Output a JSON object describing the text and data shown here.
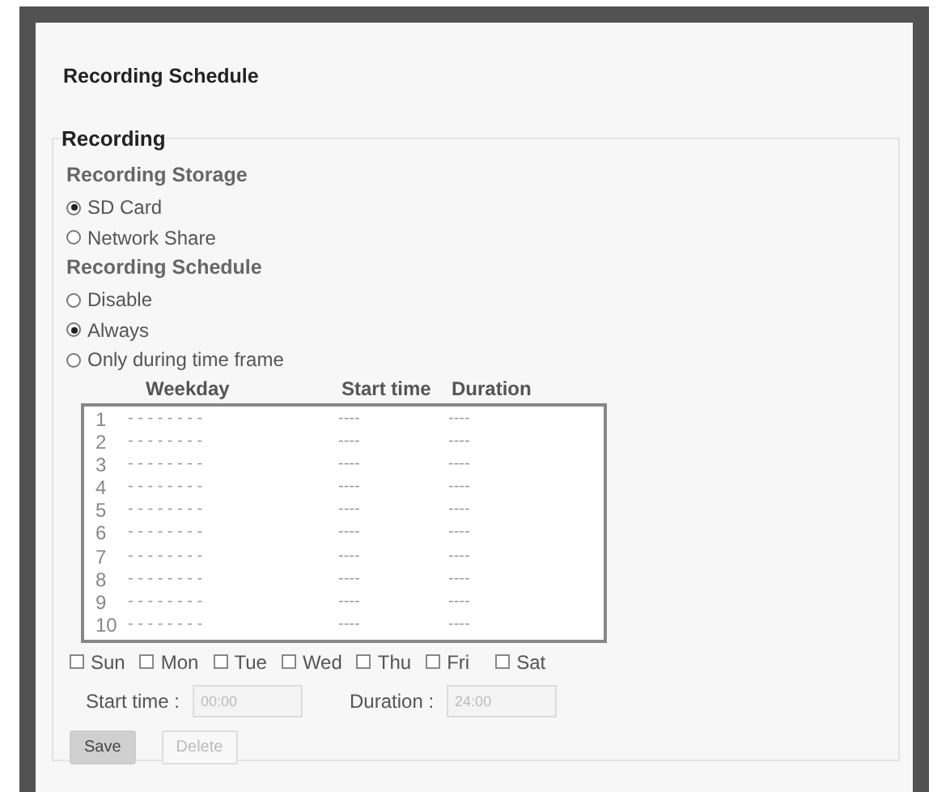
{
  "page_title": "Recording Schedule",
  "section": {
    "legend": "Recording",
    "storage": {
      "heading": "Recording Storage",
      "options": [
        {
          "label": "SD Card",
          "selected": true
        },
        {
          "label": "Network Share",
          "selected": false
        }
      ]
    },
    "schedule": {
      "heading": "Recording Schedule",
      "options": [
        {
          "label": "Disable",
          "selected": false
        },
        {
          "label": "Always",
          "selected": true
        },
        {
          "label": "Only during time frame",
          "selected": false
        }
      ]
    },
    "list": {
      "columns": [
        "Weekday",
        "Start time",
        "Duration"
      ],
      "rows": [
        {
          "index": "1",
          "weekday": "- - - - - - - -",
          "start": "----",
          "duration": "----"
        },
        {
          "index": "2",
          "weekday": "- - - - - - - -",
          "start": "----",
          "duration": "----"
        },
        {
          "index": "3",
          "weekday": "- - - - - - - -",
          "start": "----",
          "duration": "----"
        },
        {
          "index": "4",
          "weekday": "- - - - - - - -",
          "start": "----",
          "duration": "----"
        },
        {
          "index": "5",
          "weekday": "- - - - - - - -",
          "start": "----",
          "duration": "----"
        },
        {
          "index": "6",
          "weekday": "- - - - - - - -",
          "start": "----",
          "duration": "----"
        },
        {
          "index": "7",
          "weekday": "- - - - - - - -",
          "start": "----",
          "duration": "----"
        },
        {
          "index": "8",
          "weekday": "- - - - - - - -",
          "start": "----",
          "duration": "----"
        },
        {
          "index": "9",
          "weekday": "- - - - - - - -",
          "start": "----",
          "duration": "----"
        },
        {
          "index": "10",
          "weekday": "- - - - - - - -",
          "start": "----",
          "duration": "----"
        }
      ]
    },
    "days": [
      {
        "label": "Sun",
        "checked": false
      },
      {
        "label": "Mon",
        "checked": false
      },
      {
        "label": "Tue",
        "checked": false
      },
      {
        "label": "Wed",
        "checked": false
      },
      {
        "label": "Thu",
        "checked": false
      },
      {
        "label": "Fri",
        "checked": false
      },
      {
        "label": "Sat",
        "checked": false
      }
    ],
    "fields": [
      {
        "label": "Start time :",
        "value": "00:00",
        "disabled": true
      },
      {
        "label": "Duration :",
        "value": "24:00",
        "disabled": true
      }
    ],
    "buttons": [
      {
        "label": "Save",
        "disabled": false
      },
      {
        "label": "Delete",
        "disabled": true
      }
    ]
  }
}
